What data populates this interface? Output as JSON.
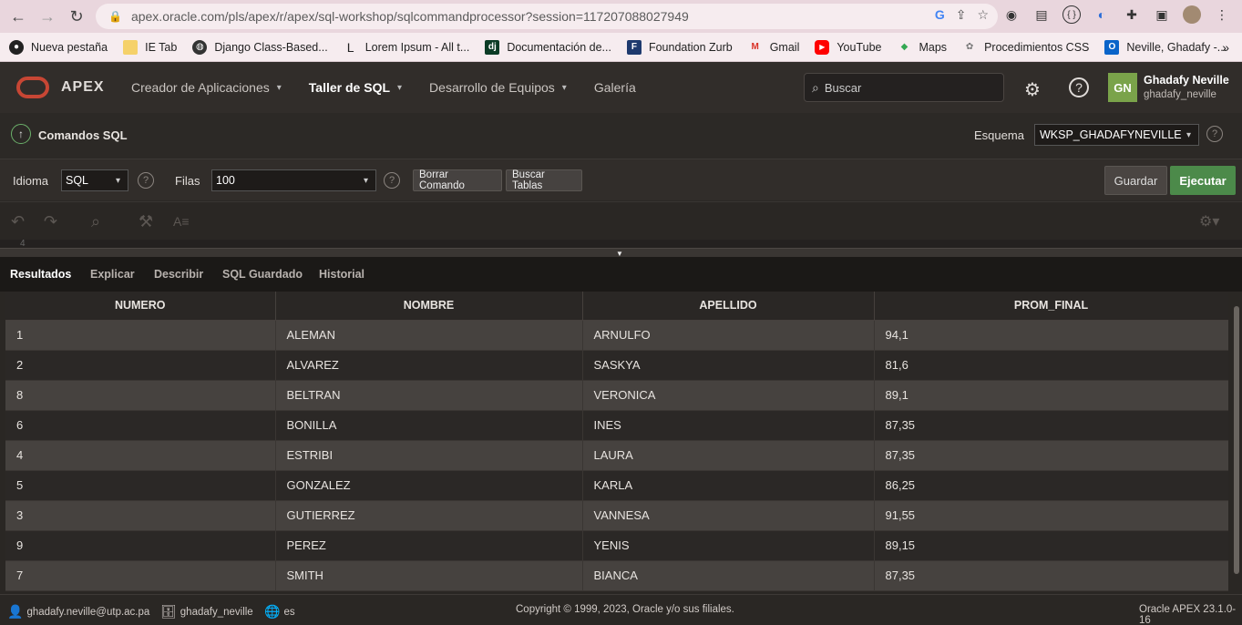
{
  "browser": {
    "url": "apex.oracle.com/pls/apex/r/apex/sql-workshop/sqlcommandprocessor?session=117207088027949",
    "bookmarks": [
      {
        "label": "Nueva pestaña",
        "icon": "bookmark-favicon"
      },
      {
        "label": "IE Tab",
        "icon": "folder-icon"
      },
      {
        "label": "Django Class-Based...",
        "icon": "globe-icon"
      },
      {
        "label": "Lorem Ipsum - All t...",
        "icon": "lorem-icon"
      },
      {
        "label": "Documentación de...",
        "icon": "django-icon"
      },
      {
        "label": "Foundation Zurb",
        "icon": "foundation-icon"
      },
      {
        "label": "Gmail",
        "icon": "gmail-icon"
      },
      {
        "label": "YouTube",
        "icon": "youtube-icon"
      },
      {
        "label": "Maps",
        "icon": "maps-icon"
      },
      {
        "label": "Procedimientos CSS",
        "icon": "css-icon"
      },
      {
        "label": "Neville, Ghadafy -...",
        "icon": "outlook-icon"
      }
    ]
  },
  "header": {
    "brand": "APEX",
    "nav": [
      {
        "label": "Creador de Aplicaciones",
        "has_menu": true
      },
      {
        "label": "Taller de SQL",
        "has_menu": true,
        "active": true
      },
      {
        "label": "Desarrollo de Equipos",
        "has_menu": true
      },
      {
        "label": "Galería",
        "has_menu": false
      }
    ],
    "search_placeholder": "Buscar",
    "user_initials": "GN",
    "user_name": "Ghadafy Neville",
    "user_id": "ghadafy_neville"
  },
  "page": {
    "title": "Comandos SQL",
    "schema_label": "Esquema",
    "schema_value": "WKSP_GHADAFYNEVILLE"
  },
  "toolbar": {
    "language_label": "Idioma",
    "language_value": "SQL",
    "rows_label": "Filas",
    "rows_value": "100",
    "clear_label": "Borrar Comando",
    "find_tables_label": "Buscar Tablas",
    "save_label": "Guardar",
    "run_label": "Ejecutar"
  },
  "editor": {
    "visible_line": "4"
  },
  "results": {
    "tabs": [
      "Resultados",
      "Explicar",
      "Describir",
      "SQL Guardado",
      "Historial"
    ],
    "columns": [
      "NUMERO",
      "NOMBRE",
      "APELLIDO",
      "PROM_FINAL"
    ],
    "rows": [
      [
        "1",
        "ALEMAN",
        "ARNULFO",
        "94,1"
      ],
      [
        "2",
        "ALVAREZ",
        "SASKYA",
        "81,6"
      ],
      [
        "8",
        "BELTRAN",
        "VERONICA",
        "89,1"
      ],
      [
        "6",
        "BONILLA",
        "INES",
        "87,35"
      ],
      [
        "4",
        "ESTRIBI",
        "LAURA",
        "87,35"
      ],
      [
        "5",
        "GONZALEZ",
        "KARLA",
        "86,25"
      ],
      [
        "3",
        "GUTIERREZ",
        "VANNESA",
        "91,55"
      ],
      [
        "9",
        "PEREZ",
        "YENIS",
        "89,15"
      ],
      [
        "7",
        "SMITH",
        "BIANCA",
        "87,35"
      ]
    ]
  },
  "footer": {
    "email": "ghadafy.neville@utp.ac.pa",
    "schema": "ghadafy_neville",
    "lang": "es",
    "copyright": "Copyright © 1999, 2023, Oracle y/o sus filiales.",
    "version": "Oracle APEX 23.1.0-16"
  }
}
